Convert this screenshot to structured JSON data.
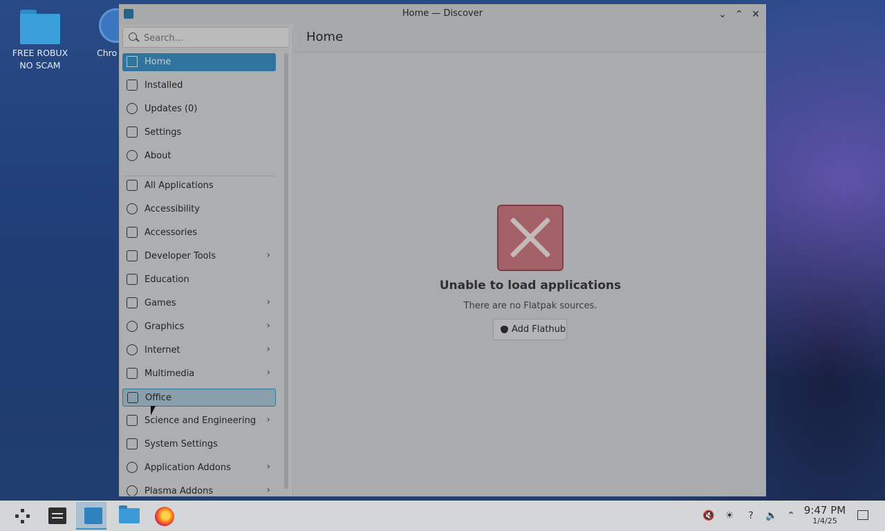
{
  "desktop": {
    "icons": [
      {
        "label": "FREE ROBUX NO SCAM"
      },
      {
        "label": "Chro"
      }
    ]
  },
  "window": {
    "title": "Home — Discover",
    "controls": {
      "minimize": "⌄",
      "maximize": "⌃",
      "close": "✕"
    }
  },
  "search": {
    "placeholder": "Search..."
  },
  "sidebar": {
    "items": [
      {
        "label": "Home",
        "icon": "home-icon"
      },
      {
        "label": "Installed",
        "icon": "installed-icon"
      },
      {
        "label": "Updates (0)",
        "icon": "updates-icon"
      },
      {
        "label": "Settings",
        "icon": "settings-icon"
      },
      {
        "label": "About",
        "icon": "info-icon"
      }
    ],
    "categories": [
      {
        "label": "All Applications",
        "icon": "grid-icon",
        "chevron": false
      },
      {
        "label": "Accessibility",
        "icon": "accessibility-icon",
        "chevron": false
      },
      {
        "label": "Accessories",
        "icon": "toolbox-icon",
        "chevron": false
      },
      {
        "label": "Developer Tools",
        "icon": "hammer-icon",
        "chevron": true
      },
      {
        "label": "Education",
        "icon": "education-icon",
        "chevron": false
      },
      {
        "label": "Games",
        "icon": "gamepad-icon",
        "chevron": true
      },
      {
        "label": "Graphics",
        "icon": "graphics-icon",
        "chevron": true
      },
      {
        "label": "Internet",
        "icon": "globe-icon",
        "chevron": true
      },
      {
        "label": "Multimedia",
        "icon": "monitor-icon",
        "chevron": true
      },
      {
        "label": "Office",
        "icon": "office-icon",
        "chevron": false
      },
      {
        "label": "Science and Engineering",
        "icon": "flask-icon",
        "chevron": true
      },
      {
        "label": "System Settings",
        "icon": "settings-icon",
        "chevron": false
      },
      {
        "label": "Application Addons",
        "icon": "addons-icon",
        "chevron": true
      },
      {
        "label": "Plasma Addons",
        "icon": "plasma-icon",
        "chevron": true
      }
    ],
    "chevron": "›"
  },
  "page": {
    "title": "Home",
    "error_title": "Unable to load applications",
    "error_subtitle": "There are no Flatpak sources.",
    "add_button": "Add Flathub"
  },
  "taskbar": {
    "clock": {
      "time": "9:47 PM",
      "date": "1/4/25"
    }
  },
  "colors": {
    "accent": "#3a8fc3",
    "error": "#c8777e"
  }
}
